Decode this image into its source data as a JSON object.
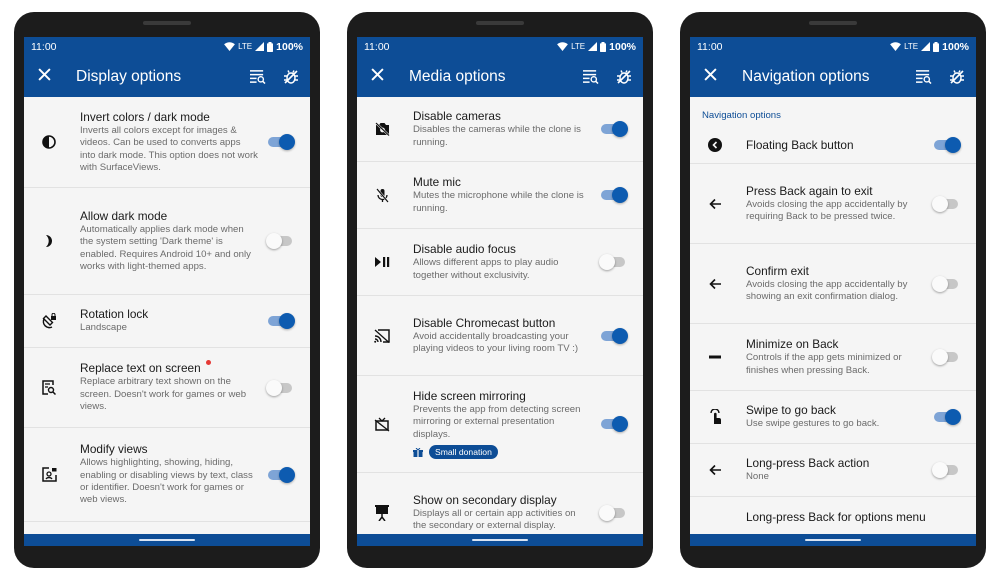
{
  "phones": [
    {
      "status": {
        "time": "11:00",
        "network": "LTE",
        "battery": "100%"
      },
      "toolbar": {
        "title": "Display options"
      },
      "items": [
        {
          "title": "Invert colors / dark mode",
          "subtitle": "Inverts all colors except for images & videos. Can be used to converts apps into dark mode. This option does not work with SurfaceViews.",
          "icon": "contrast-icon",
          "enabled": true
        },
        {
          "title": "Allow dark mode",
          "subtitle": "Automatically applies dark mode when the system setting 'Dark theme' is enabled. Requires Android 10+ and only works with light-themed apps.",
          "icon": "moon-icon",
          "enabled": false
        },
        {
          "title": "Rotation lock",
          "subtitle": "Landscape",
          "icon": "rotation-lock-icon",
          "enabled": true
        },
        {
          "title": "Replace text on screen",
          "subtitle": "Replace arbitrary text shown on the screen. Doesn't work for games or web views.",
          "icon": "find-replace-icon",
          "enabled": false,
          "new_badge": true
        },
        {
          "title": "Modify views",
          "subtitle": "Allows highlighting, showing, hiding, enabling or disabling views by text, class or identifier. Doesn't work for games or web views.",
          "icon": "view-edit-icon",
          "enabled": true
        }
      ]
    },
    {
      "status": {
        "time": "11:00",
        "network": "LTE",
        "battery": "100%"
      },
      "toolbar": {
        "title": "Media options"
      },
      "items": [
        {
          "title": "Disable cameras",
          "subtitle": "Disables the cameras while the clone is running.",
          "icon": "camera-off-icon",
          "enabled": true
        },
        {
          "title": "Mute mic",
          "subtitle": "Mutes the microphone while the clone is running.",
          "icon": "mic-off-icon",
          "enabled": true
        },
        {
          "title": "Disable audio focus",
          "subtitle": "Allows different apps to play audio together without exclusivity.",
          "icon": "play-pause-icon",
          "enabled": false
        },
        {
          "title": "Disable Chromecast button",
          "subtitle": "Avoid accidentally broadcasting your playing videos to your living room TV :)",
          "icon": "cast-off-icon",
          "enabled": true
        },
        {
          "title": "Hide screen mirroring",
          "subtitle": "Prevents the app from detecting screen mirroring or external presentation displays.",
          "icon": "tv-off-icon",
          "enabled": true,
          "badge": "Small donation"
        },
        {
          "title": "Show on secondary display",
          "subtitle": "Displays all or certain app activities on the secondary or external display.",
          "icon": "presentation-icon",
          "enabled": false
        }
      ]
    },
    {
      "status": {
        "time": "11:00",
        "network": "LTE",
        "battery": "100%"
      },
      "toolbar": {
        "title": "Navigation options"
      },
      "section_header": "Navigation options",
      "items": [
        {
          "title": "Floating Back button",
          "subtitle": "",
          "icon": "back-circle-icon",
          "enabled": true
        },
        {
          "title": "Press Back again to exit",
          "subtitle": "Avoids closing the app accidentally by requiring Back to be pressed twice.",
          "icon": "arrow-back-icon",
          "enabled": false
        },
        {
          "title": "Confirm exit",
          "subtitle": "Avoids closing the app accidentally by showing an exit confirmation dialog.",
          "icon": "arrow-back-icon",
          "enabled": false
        },
        {
          "title": "Minimize on Back",
          "subtitle": "Controls if the app gets minimized or finishes when pressing Back.",
          "icon": "minimize-icon",
          "enabled": false
        },
        {
          "title": "Swipe to go back",
          "subtitle": "Use swipe gestures to go back.",
          "icon": "swipe-gesture-icon",
          "enabled": true
        },
        {
          "title": "Long-press Back action",
          "subtitle": "None",
          "icon": "arrow-back-icon",
          "enabled": false
        },
        {
          "title": "Long-press Back for options menu",
          "subtitle": "",
          "icon": "",
          "enabled": false
        }
      ]
    }
  ],
  "colors": {
    "primary": "#0d4d96",
    "accent": "#0d5bb0",
    "badge_dot": "#e53935"
  }
}
